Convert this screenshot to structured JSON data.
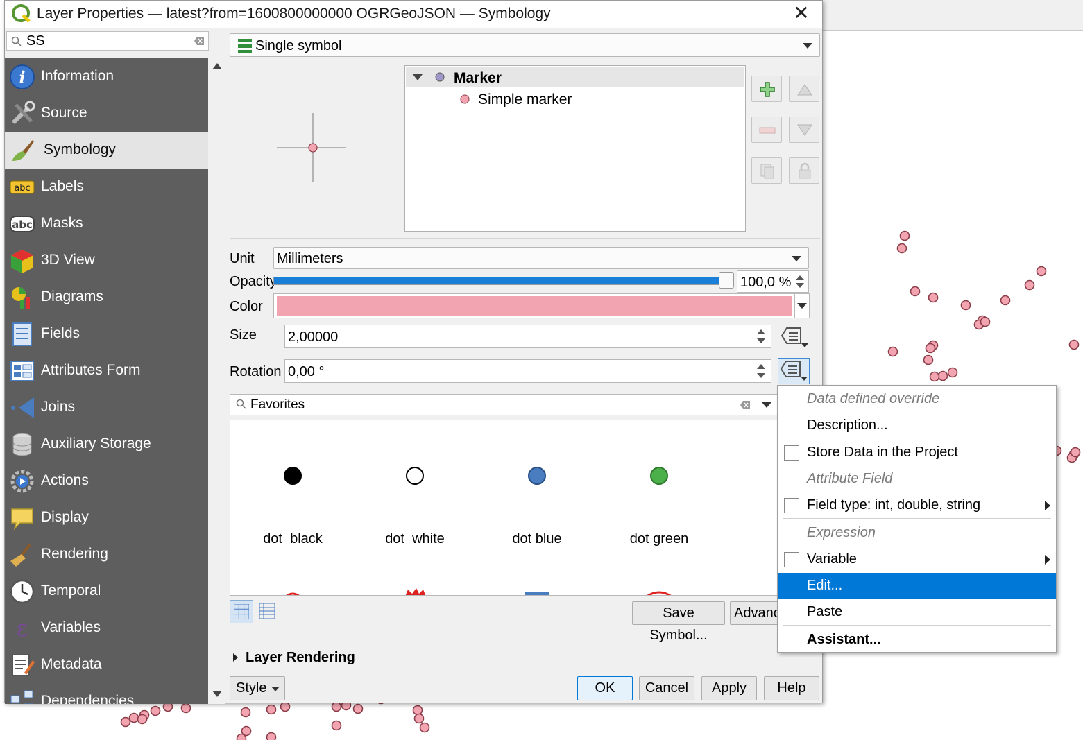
{
  "window": {
    "title": "Layer Properties — latest?from=1600800000000 OGRGeoJSON — Symbology",
    "close_glyph": "✕"
  },
  "sidebar": {
    "search_value": "SS",
    "items": [
      {
        "label": "Information",
        "icon": "info-icon"
      },
      {
        "label": "Source",
        "icon": "source-tools-icon"
      },
      {
        "label": "Symbology",
        "icon": "paintbrush-icon",
        "active": true
      },
      {
        "label": "Labels",
        "icon": "labels-abc-icon"
      },
      {
        "label": "Masks",
        "icon": "masks-abc-icon"
      },
      {
        "label": "3D View",
        "icon": "cube-icon"
      },
      {
        "label": "Diagrams",
        "icon": "diagrams-icon"
      },
      {
        "label": "Fields",
        "icon": "fields-icon"
      },
      {
        "label": "Attributes Form",
        "icon": "form-icon"
      },
      {
        "label": "Joins",
        "icon": "joins-icon"
      },
      {
        "label": "Auxiliary Storage",
        "icon": "database-icon"
      },
      {
        "label": "Actions",
        "icon": "actions-gear-icon"
      },
      {
        "label": "Display",
        "icon": "speech-bubble-icon"
      },
      {
        "label": "Rendering",
        "icon": "broom-icon"
      },
      {
        "label": "Temporal",
        "icon": "clock-icon"
      },
      {
        "label": "Variables",
        "icon": "epsilon-icon"
      },
      {
        "label": "Metadata",
        "icon": "metadata-icon"
      },
      {
        "label": "Dependencies",
        "icon": "dependencies-icon"
      }
    ]
  },
  "renderer": {
    "type_label": "Single symbol"
  },
  "symbol_tree": {
    "root_label": "Marker",
    "child_label": "Simple marker"
  },
  "properties": {
    "unit_label": "Unit",
    "unit_value": "Millimeters",
    "opacity_label": "Opacity",
    "opacity_value": "100,0 %",
    "opacity_fraction": 1.0,
    "color_label": "Color",
    "color_value": "#f2a5b0",
    "size_label": "Size",
    "size_value": "2,00000",
    "rotation_label": "Rotation",
    "rotation_value": "0,00 °"
  },
  "library": {
    "search_value": "Favorites",
    "symbols": [
      {
        "label": "dot  black",
        "fill": "#000000",
        "stroke": "#000000"
      },
      {
        "label": "dot  white",
        "fill": "#ffffff",
        "stroke": "#000000"
      },
      {
        "label": "dot blue",
        "fill": "#4a7cc0",
        "stroke": "#2a4f86"
      },
      {
        "label": "dot green",
        "fill": "#4cb04a",
        "stroke": "#2e7a2d"
      }
    ],
    "save_label": "Save Symbol...",
    "advanced_label": "Advanced"
  },
  "layer_rendering": {
    "label": "Layer Rendering"
  },
  "footer": {
    "style_label": "Style",
    "ok_label": "OK",
    "cancel_label": "Cancel",
    "apply_label": "Apply",
    "help_label": "Help"
  },
  "context_menu": {
    "header_ddo": "Data defined override",
    "description": "Description...",
    "store_data": "Store Data in the Project",
    "header_attribute": "Attribute Field",
    "field_type": "Field type: int, double, string",
    "header_expression": "Expression",
    "variable": "Variable",
    "edit": "Edit...",
    "paste": "Paste",
    "assistant": "Assistant..."
  },
  "colors": {
    "accent": "#0078d7",
    "sidebar_bg": "#5e5e5e",
    "map_point": "#f2a5b0"
  }
}
